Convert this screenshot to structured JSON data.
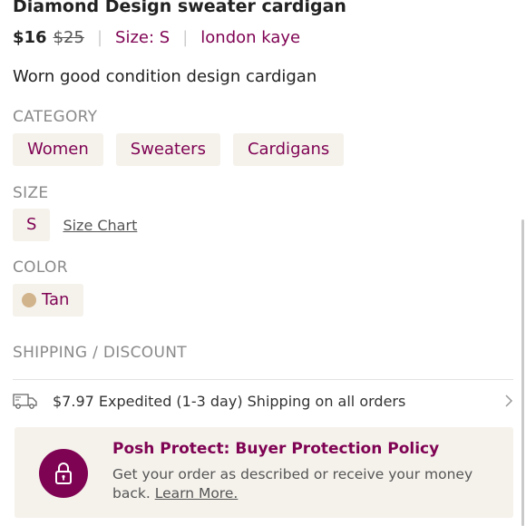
{
  "listing": {
    "title": "Diamond Design sweater cardigan",
    "price": "$16",
    "original_price": "$25",
    "size_text": "Size: S",
    "brand": "london kaye",
    "separator": "|",
    "description": "Worn good condition design cardigan"
  },
  "category": {
    "label": "CATEGORY",
    "items": [
      "Women",
      "Sweaters",
      "Cardigans"
    ]
  },
  "size": {
    "label": "SIZE",
    "value": "S",
    "size_chart_link": "Size Chart"
  },
  "color": {
    "label": "COLOR",
    "value": "Tan",
    "swatch_hex": "#d2b48c"
  },
  "shipping": {
    "label": "SHIPPING / DISCOUNT",
    "text": "$7.97 Expedited (1-3 day) Shipping on all orders",
    "icon": "truck-icon"
  },
  "protect": {
    "title": "Posh Protect: Buyer Protection Policy",
    "body": "Get your order as described or receive your money back.",
    "link": "Learn More.",
    "icon": "lock-icon"
  },
  "colors": {
    "brand": "#7f0353",
    "chip_bg": "#f5f2ec",
    "muted_label": "#8a8a8a"
  }
}
